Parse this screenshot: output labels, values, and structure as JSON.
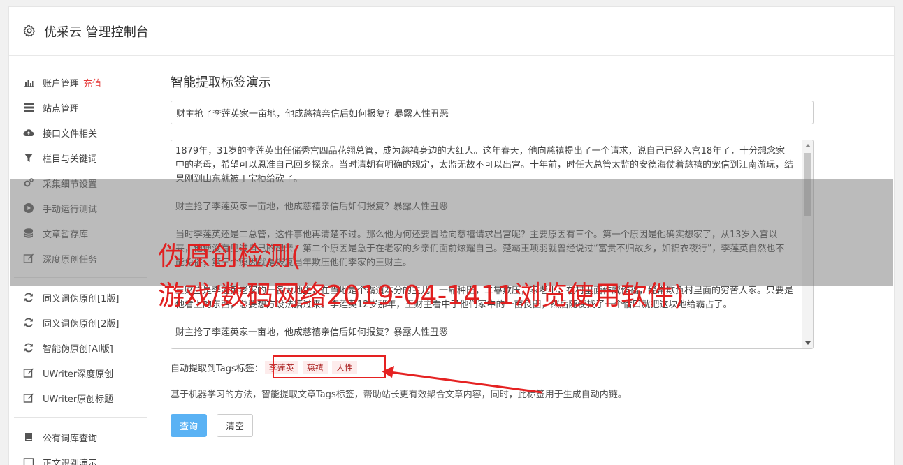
{
  "header": {
    "title": "优采云 管理控制台",
    "icon": "gear-icon"
  },
  "sidebar": {
    "group1": [
      {
        "label": "账户管理",
        "badge": "充值",
        "icon": "bar-chart-icon"
      },
      {
        "label": "站点管理",
        "icon": "server-icon"
      },
      {
        "label": "接口文件相关",
        "icon": "cloud-upload-icon"
      },
      {
        "label": "栏目与关键词",
        "icon": "filter-icon"
      },
      {
        "label": "采集细节设置",
        "icon": "gears-icon"
      },
      {
        "label": "手动运行测试",
        "icon": "play-icon"
      },
      {
        "label": "文章暂存库",
        "icon": "database-icon"
      },
      {
        "label": "深度原创任务",
        "icon": "edit-icon"
      }
    ],
    "group2": [
      {
        "label": "同义词伪原创[1版]",
        "icon": "refresh-icon"
      },
      {
        "label": "同义词伪原创[2版]",
        "icon": "refresh-icon"
      },
      {
        "label": "智能伪原创[AI版]",
        "icon": "refresh-icon"
      },
      {
        "label": "UWriter深度原创",
        "icon": "edit-icon"
      },
      {
        "label": "UWriter原创标题",
        "icon": "edit-icon"
      }
    ],
    "group3": [
      {
        "label": "公有词库查询",
        "icon": "book-icon"
      },
      {
        "label": "正文识别演示",
        "icon": "window-icon"
      }
    ]
  },
  "main": {
    "page_title": "智能提取标签演示",
    "title_value": "财主抢了李莲英家一亩地，他成慈禧亲信后如何报复？暴露人性丑恶",
    "content_paragraphs": [
      "1879年，31岁的李莲英出任储秀宫四品花翎总管，成为慈禧身边的大红人。这年春天，他向慈禧提出了一个请求，说自己已经入宫18年了，十分想念家中的老母，希望可以恩准自己回乡探亲。当时清朝有明确的规定，太监无故不可以出宫。十年前，时任大总管太监的安德海仗着慈禧的宠信到江南游玩，结果刚到山东就被丁宝桢给砍了。",
      "财主抢了李莲英家一亩地，他成慈禧亲信后如何报复？暴露人性丑恶",
      "当时李莲英还是二总管，这件事他再清楚不过。那么他为何还要冒险向慈禧请求出宫呢？主要原因有三个。第一个原因是他确实想家了，从13岁入宫以来，他便没有见过自己的母亲；第二个原因是急于在老家的乡亲们面前炫耀自己。楚霸王项羽就曾经说过“富贵不归故乡，如锦衣夜行”，李莲英自然也不能免俗；第三个原因就是报复当年欺压他们李家的王财主。",
      "王财主是李莲英老家的一名大地主，在当地是个霸道本分的主儿，一靠种田，二靠欺压，家老小，在村里面作威作福，经常欺负村里面的穷苦人家。只要是他看上的东西，总要想方设法搞过来。李莲英12岁那年，王财主看中了他们家中的一亩良田，然后随便找了一个借口就把这块地给霸占了。",
      "财主抢了李莲英家一亩地，他成慈禧亲信后如何报复？暴露人性丑恶"
    ],
    "tags_label": "自动提取到Tags标签：",
    "tags": [
      "李莲英",
      "慈禧",
      "人性"
    ],
    "description": "基于机器学习的方法，智能提取文章Tags标签，帮助站长更有效聚合文章内容，同时，此标签用于生成自动内链。",
    "query_button": "查询",
    "clear_button": "清空"
  },
  "watermark": {
    "line1": "伪原创检测(",
    "line2": "游戏/数码网络2019-04-1411浏览使用软件)"
  },
  "colors": {
    "accent": "#5ab2f4",
    "red": "#e52222"
  }
}
